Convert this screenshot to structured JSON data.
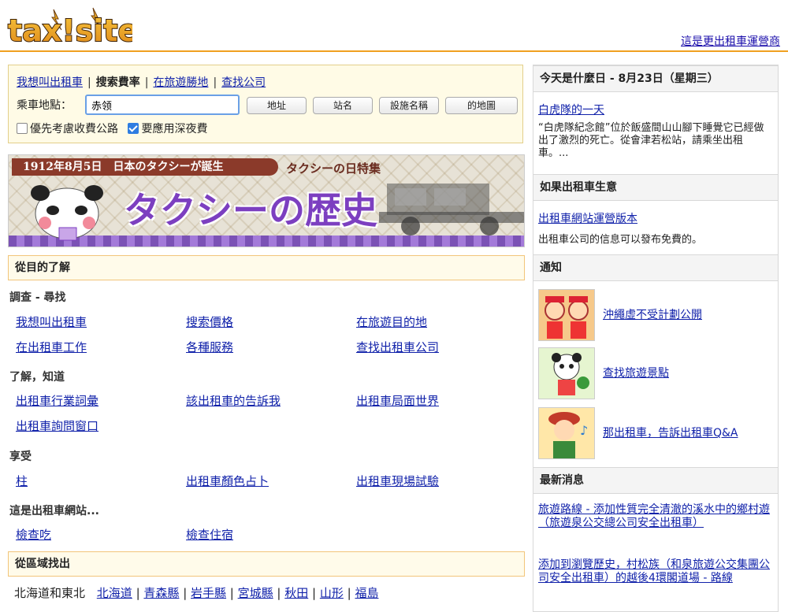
{
  "header": {
    "logo_text": "tax!site",
    "operator_link": "這是更出租車運營商"
  },
  "search": {
    "tabs": [
      {
        "label": "我想叫出租車",
        "current": false
      },
      {
        "label": "搜索費率",
        "current": true
      },
      {
        "label": "在旅遊勝地",
        "current": false
      },
      {
        "label": "查找公司",
        "current": false
      }
    ],
    "ride_label": "乘車地點：",
    "ride_value": "赤领",
    "buttons": [
      "地址",
      "站名",
      "設施名稱",
      "的地圖"
    ],
    "options": [
      {
        "label": "優先考慮收費公路",
        "checked": false
      },
      {
        "label": "要應用深夜費",
        "checked": true
      }
    ]
  },
  "banner": {
    "date_ribbon": "1912年8月5日　日本のタクシーが誕生",
    "special": "タクシーの日特集",
    "title": "タクシーの歴史"
  },
  "purpose": {
    "heading": "從目的了解",
    "groups": [
      {
        "title": "調查 - 尋找",
        "links": [
          "我想叫出租車",
          "搜索價格",
          "在旅遊目的地",
          "在出租車工作",
          "各種服務",
          "查找出租車公司"
        ]
      },
      {
        "title": "了解，知道",
        "links": [
          "出租車行業詞彙",
          "該出租車的告訴我",
          "出租車局面世界",
          "出租車詢問窗口"
        ]
      },
      {
        "title": "享受",
        "links": [
          "柱",
          "出租車顏色占卜",
          "出租車現場試驗"
        ]
      },
      {
        "title": "這是出租車網站...",
        "links": [
          "檢查吃",
          "檢查住宿"
        ]
      }
    ]
  },
  "region": {
    "heading": "從區域找出",
    "area_label": "北海道和東北",
    "prefectures": [
      "北海道",
      "青森縣",
      "岩手縣",
      "宮城縣",
      "秋田",
      "山形",
      "福島"
    ]
  },
  "sidebar": {
    "today_heading": "今天是什麼日 - 8月23日（星期三）",
    "today_link": "白虎隊的一天",
    "today_text": "“白虎隊紀念館”位於飯盛間山山腳下睡覺它已經做出了激烈的死亡。從會津若松站，請乘坐出租車。...",
    "business_heading": "如果出租車生意",
    "business_link": "出租車網站運營版本",
    "business_text": "出租車公司的信息可以發布免費的。",
    "notice_heading": "通知",
    "notices": [
      {
        "label": "沖繩虛不受計劃公開",
        "icon": "okinawa-characters-icon"
      },
      {
        "label": "查找旅遊景點",
        "icon": "panda-mascot-icon"
      },
      {
        "label": "那出租車，告訴出租車Q&A",
        "icon": "girl-mascot-icon"
      }
    ],
    "news_heading": "最新消息",
    "news": [
      "旅遊路線 - 添加性質完全清澈的溪水中的鄉村遊（旅遊泉公交總公司安全出租車）",
      "添加到瀏覽歷史，村松族（和泉旅遊公交集團公司安全出租車）的越後4環閣道場 - 路線"
    ]
  },
  "colors": {
    "accent_orange": "#f0a020",
    "link_blue": "#1122aa",
    "banner_purple": "#7c3fc0"
  }
}
